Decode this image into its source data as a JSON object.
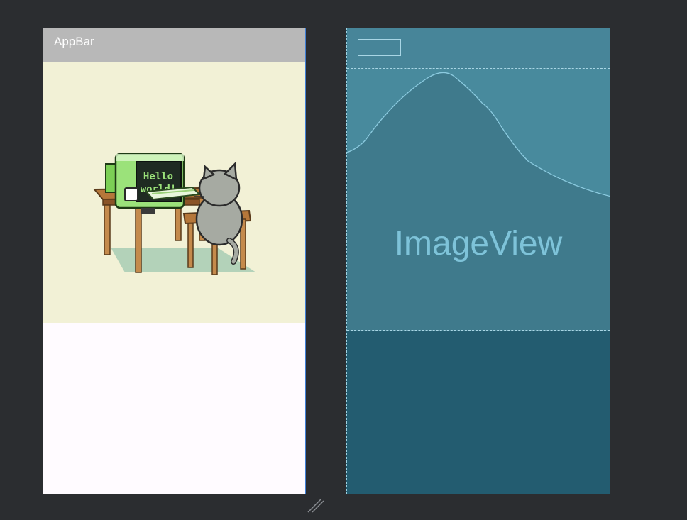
{
  "design_preview": {
    "appbar": {
      "title": "AppBar"
    },
    "image": {
      "description_icon": "pixel-art-cat-computer",
      "screen_text_line1": "Hello",
      "screen_text_line2": "world!"
    }
  },
  "blueprint_preview": {
    "image_label": "ImageView"
  },
  "colors": {
    "canvas_bg": "#2b2d30",
    "appbar_bg": "#b8b8b8",
    "image_bg": "#f2f1d6",
    "selection_border": "#3f7fd6",
    "blueprint_bg": "#235c70",
    "blueprint_appbar": "#478599",
    "blueprint_image": "#3f7a8c",
    "blueprint_line": "#a9d6e5",
    "blueprint_text": "#7ec3d9"
  }
}
